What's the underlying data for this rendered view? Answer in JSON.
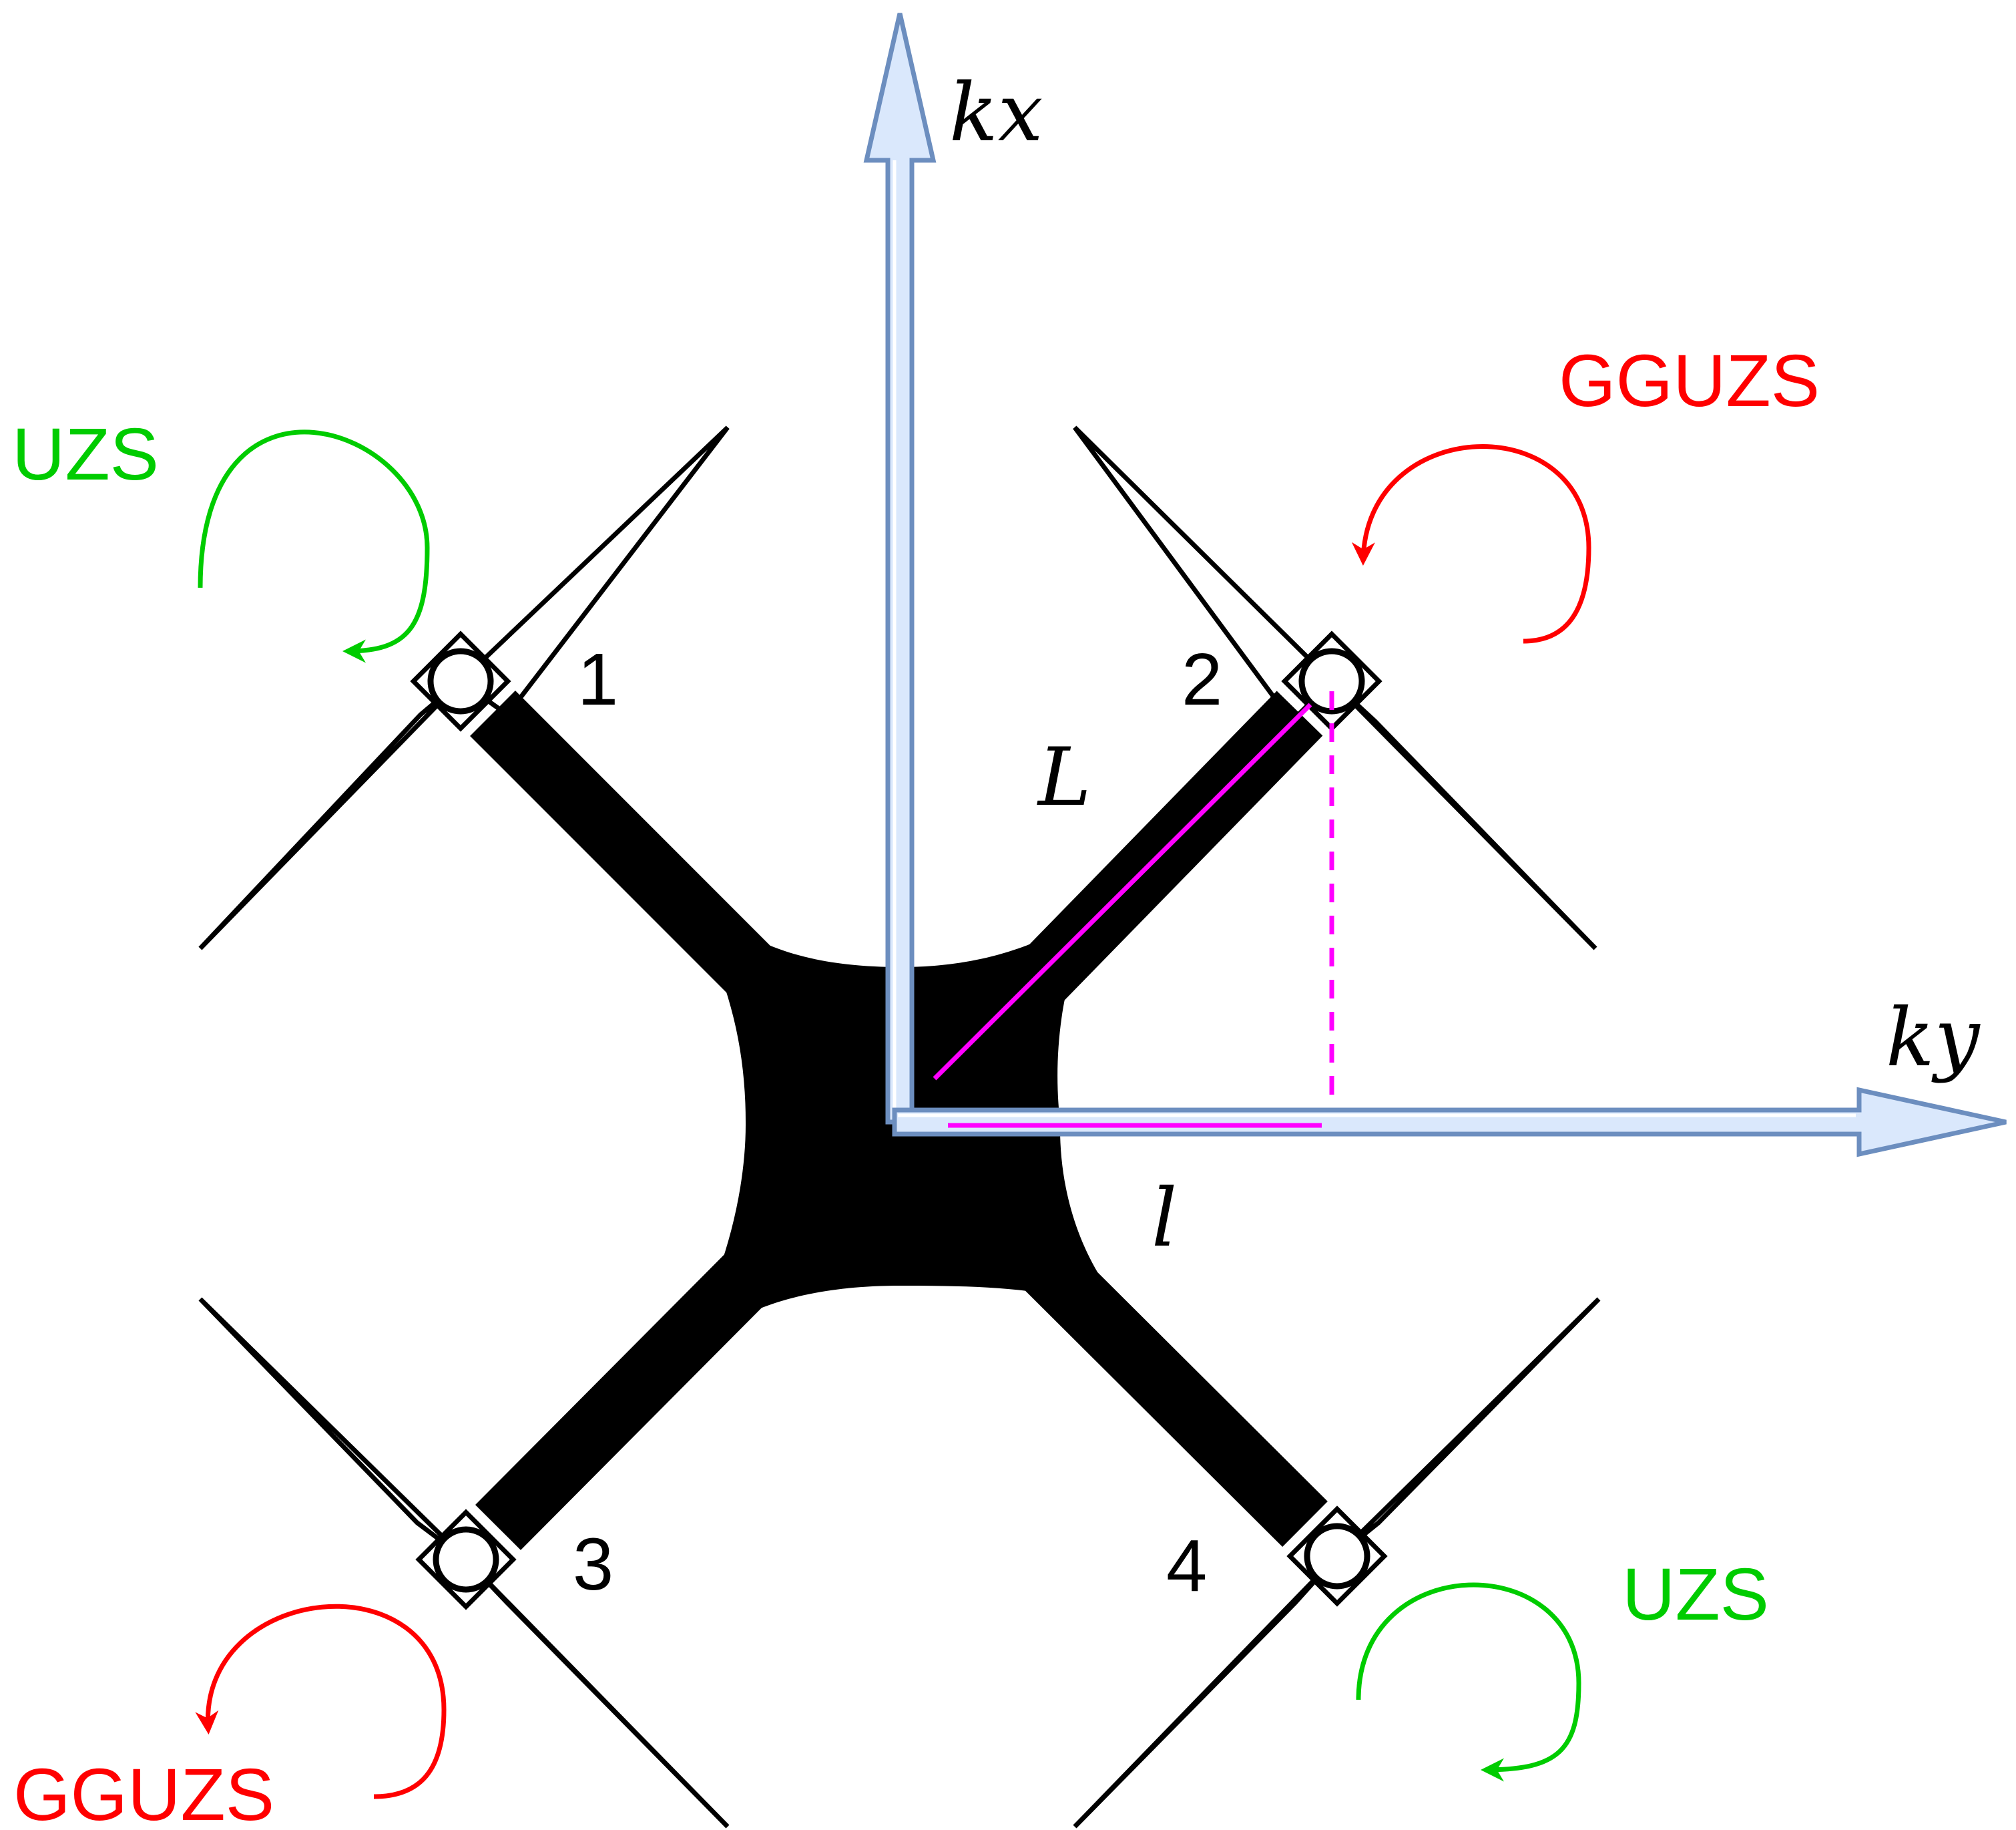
{
  "axes": {
    "x_label": "kx",
    "y_label": "ky"
  },
  "dimensions": {
    "arm_length_label": "L",
    "projection_label": "l"
  },
  "motors": [
    {
      "number": "1",
      "rotation": "UZS",
      "rotation_color": "#00cc00"
    },
    {
      "number": "2",
      "rotation": "GGUZS",
      "rotation_color": "#ff0000"
    },
    {
      "number": "3",
      "rotation": "GGUZS",
      "rotation_color": "#ff0000"
    },
    {
      "number": "4",
      "rotation": "UZS",
      "rotation_color": "#00cc00"
    }
  ],
  "colors": {
    "axis_fill": "#dae8fc",
    "axis_stroke": "#6c8ebf",
    "dimension": "#ff00ff",
    "frame": "#000000",
    "counter_clockwise": "#ff0000",
    "clockwise": "#00cc00"
  }
}
